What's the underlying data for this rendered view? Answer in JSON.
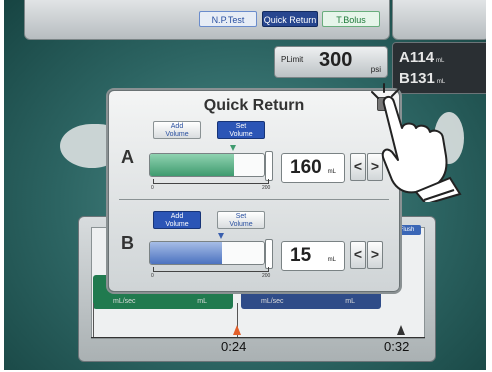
{
  "top_bar": {
    "np_test": "N.P.Test",
    "quick_return": "Quick Return",
    "t_bolus": "T.Bolus"
  },
  "plimit": {
    "label": "PLimit",
    "value": "300",
    "unit": "psi"
  },
  "status": {
    "a_label": "A",
    "a_value": "114",
    "a_unit": "mL",
    "b_label": "B",
    "b_value": "131",
    "b_unit": "mL"
  },
  "graph": {
    "flush": "Flush",
    "tile_unit_rate": "mL/sec",
    "tile_unit_vol": "mL",
    "time_1": "0:24",
    "time_2": "0:32"
  },
  "dialog": {
    "title": "Quick Return",
    "a": {
      "label": "A",
      "add_volume": "Add\nVolume",
      "set_volume": "Set\nVolume",
      "value": "160",
      "unit": "mL",
      "fill_fraction": 0.72,
      "marker_fraction": 0.72,
      "scale_min": "0",
      "scale_max": "200"
    },
    "b": {
      "label": "B",
      "add_volume": "Add\nVolume",
      "set_volume": "Set\nVolume",
      "value": "15",
      "unit": "mL",
      "fill_fraction": 0.62,
      "marker_fraction": 0.62,
      "scale_min": "0",
      "scale_max": "200"
    },
    "prev": "<",
    "next": ">"
  },
  "colors": {
    "green": "#4aa37a",
    "blue": "#4c72c0",
    "accent": "#2b55b6"
  }
}
